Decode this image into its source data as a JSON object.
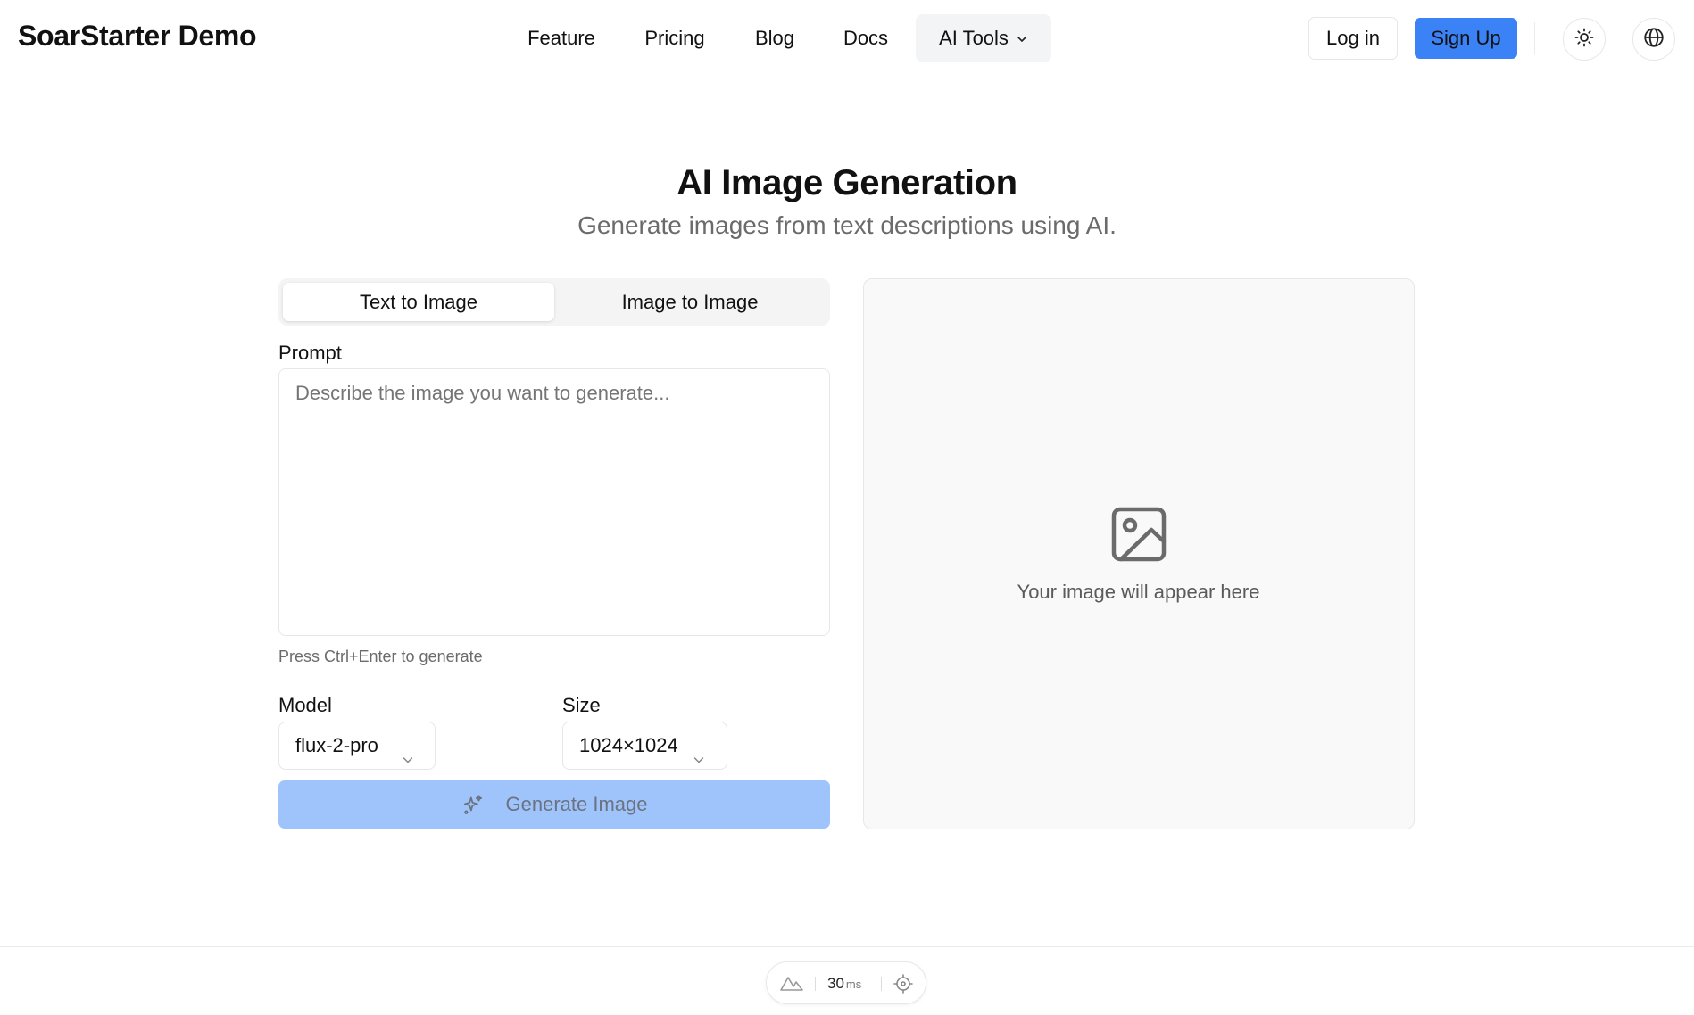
{
  "header": {
    "brand": "SoarStarter Demo",
    "nav": [
      {
        "label": "Feature"
      },
      {
        "label": "Pricing"
      },
      {
        "label": "Blog"
      },
      {
        "label": "Docs"
      },
      {
        "label": "AI Tools",
        "has_dropdown": true
      }
    ],
    "login_label": "Log in",
    "signup_label": "Sign Up",
    "theme_icon": "sun-icon",
    "language_icon": "globe-icon"
  },
  "hero": {
    "title": "AI Image Generation",
    "subtitle": "Generate images from text descriptions using AI."
  },
  "form": {
    "tabs": [
      {
        "label": "Text to Image",
        "active": true
      },
      {
        "label": "Image to Image",
        "active": false
      }
    ],
    "prompt_label": "Prompt",
    "prompt_placeholder": "Describe the image you want to generate...",
    "prompt_value": "",
    "hint": "Press Ctrl+Enter to generate",
    "model_label": "Model",
    "model_value": "flux-2-pro",
    "size_label": "Size",
    "size_value": "1024×1024",
    "generate_label": "Generate Image"
  },
  "preview": {
    "icon": "image-icon",
    "placeholder_text": "Your image will appear here"
  },
  "perf_widget": {
    "value": "30",
    "unit": "ms"
  },
  "colors": {
    "accent": "#3b82f6",
    "accent_disabled": "#9fc4fb",
    "border": "#e5e7eb",
    "muted_text": "#6b6b6b"
  }
}
